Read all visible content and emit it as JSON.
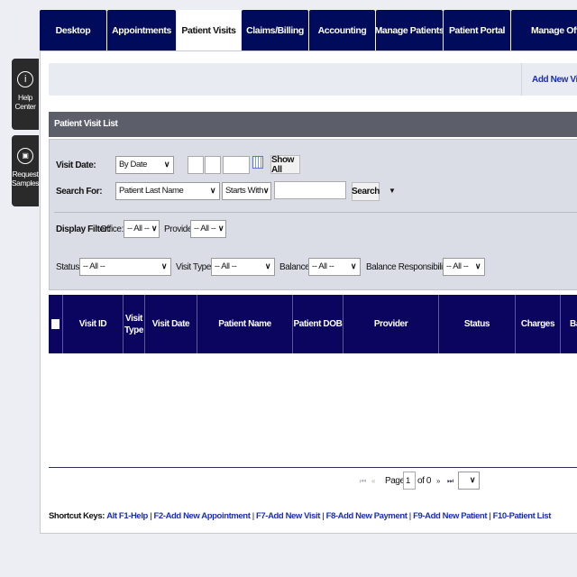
{
  "tabs": [
    "Desktop",
    "Appointments",
    "Patient Visits",
    "Claims/Billing",
    "Accounting",
    "Manage Patients",
    "Patient Portal",
    "Manage Offic"
  ],
  "active_tab": "Patient Visits",
  "side": {
    "help": {
      "icon": "info-icon",
      "label1": "Help",
      "label2": "Center"
    },
    "samples": {
      "icon": "bottle-icon",
      "label1": "Request",
      "label2": "Samples"
    }
  },
  "toolbar": {
    "add_new_visit": "Add New Visi"
  },
  "section_title": "Patient Visit List",
  "filters": {
    "visit_date_label": "Visit Date:",
    "visit_date_mode": "By Date",
    "show_all": "Show All",
    "search_for_label": "Search For:",
    "search_field": "Patient Last Name",
    "search_match": "Starts With",
    "search_value": "",
    "search_button": "Search",
    "more": "▼",
    "display_filter_label": "Display Filter:",
    "office_label": "Office:",
    "office_value": "-- All --",
    "provider_label": "Provider:",
    "provider_value": "-- All --",
    "status_label": "Status:",
    "status_value": "-- All --",
    "visit_type_label": "Visit Type:",
    "visit_type_value": "-- All --",
    "balance_label": "Balance:",
    "balance_value": "-- All --",
    "balance_resp_label": "Balance Responsibility:",
    "balance_resp_value": "-- All --"
  },
  "table": {
    "columns": [
      "Visit ID",
      "Visit Type",
      "Visit Date",
      "Patient Name",
      "Patient DOB",
      "Provider",
      "Status",
      "Charges",
      "Ba"
    ],
    "rows": []
  },
  "pager": {
    "page_label": "Page",
    "page": "1",
    "of_label": "of 0"
  },
  "shortcuts": {
    "label": "Shortcut Keys:",
    "items": [
      "Alt F1-Help",
      "F2-Add New Appointment",
      "F7-Add New Visit",
      "F8-Add New Payment",
      "F9-Add New Patient",
      "F10-Patient List"
    ]
  },
  "colors": {
    "nav": "#000b5c",
    "table_header": "#0b0560",
    "section_header": "#5c5f6a",
    "link": "#1a2fb0"
  }
}
